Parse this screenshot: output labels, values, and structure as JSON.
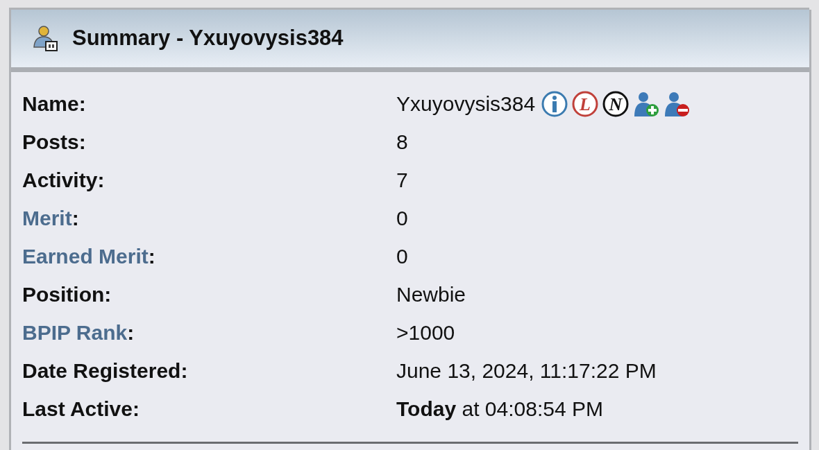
{
  "panel": {
    "title": "Summary - Yxuyovysis384"
  },
  "rows": [
    {
      "label": "Name",
      "link": false,
      "colon": ":",
      "value": "Yxuyovysis384",
      "icons": [
        {
          "kind": "info",
          "color": "#3b7bb0"
        },
        {
          "kind": "letter",
          "text": "L",
          "color": "#c0403a"
        },
        {
          "kind": "letter",
          "text": "N",
          "color": "#111111"
        },
        {
          "kind": "user-add",
          "color": "#2e9e3e"
        },
        {
          "kind": "user-remove",
          "color": "#c81e1e"
        }
      ]
    },
    {
      "label": "Posts",
      "link": false,
      "colon": ":",
      "value": "8"
    },
    {
      "label": "Activity",
      "link": false,
      "colon": ":",
      "value": "7"
    },
    {
      "label": "Merit",
      "link": true,
      "colon": ":",
      "value": "0"
    },
    {
      "label": "Earned Merit",
      "link": true,
      "colon": ":",
      "value": "0"
    },
    {
      "label": "Position",
      "link": false,
      "colon": ":",
      "value": "Newbie"
    },
    {
      "label": "BPIP Rank",
      "link": true,
      "colon": ":",
      "value": ">1000"
    },
    {
      "label": "Date Registered",
      "link": false,
      "colon": ":",
      "value": "June 13, 2024, 11:17:22 PM"
    },
    {
      "label": "Last Active",
      "link": false,
      "colon": ":",
      "value": "**Today** at 04:08:54 PM"
    }
  ]
}
